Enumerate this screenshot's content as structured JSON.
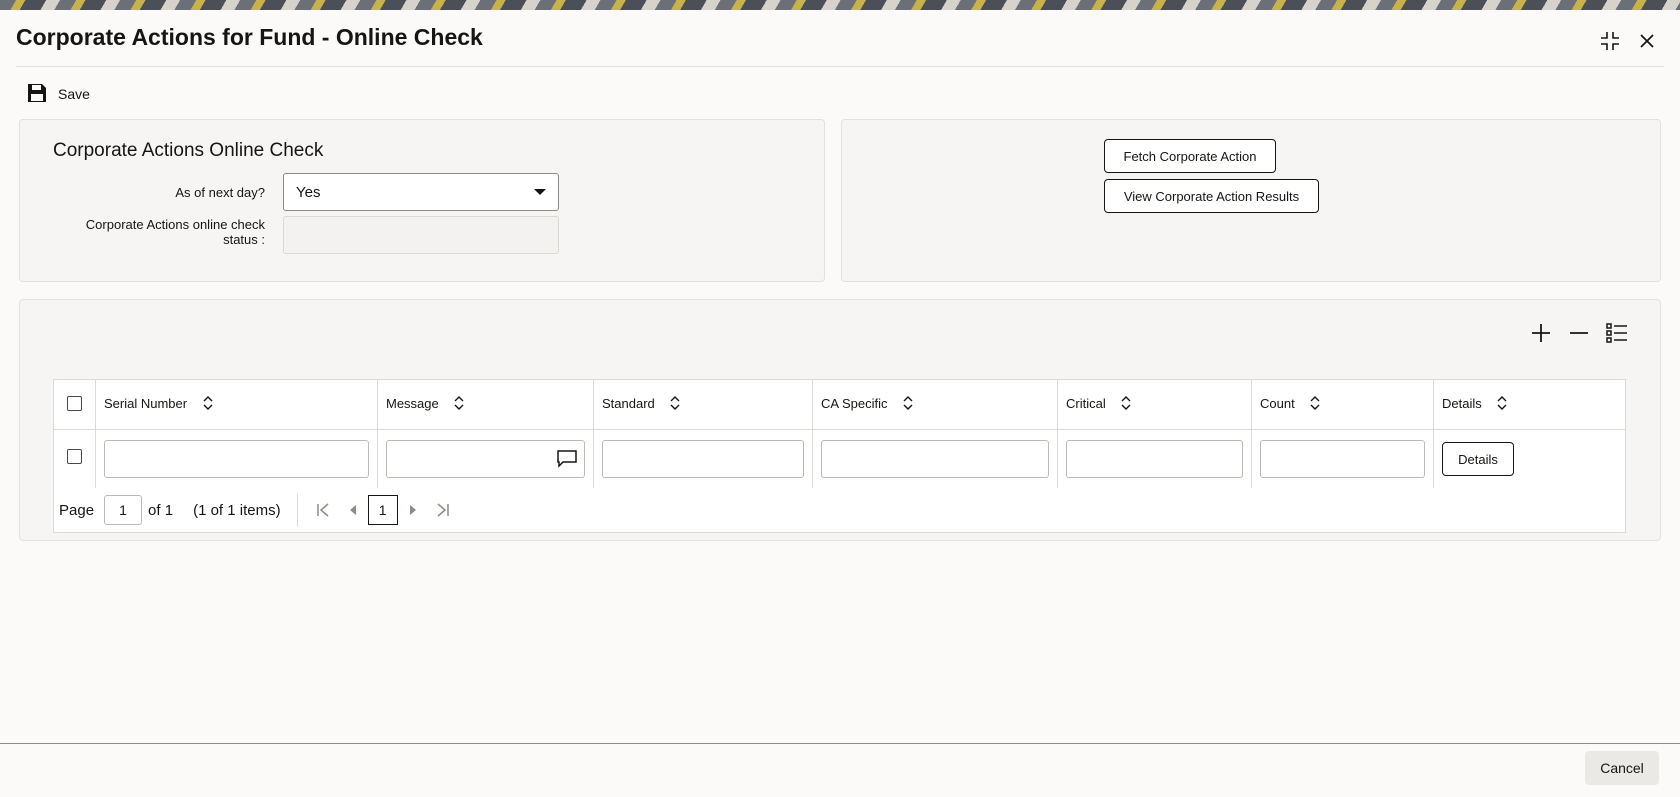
{
  "window": {
    "title": "Corporate Actions for Fund - Online Check",
    "maximize_icon": "collapse-icon",
    "close_icon": "close-icon"
  },
  "toolbar": {
    "save_label": "Save",
    "save_icon": "floppy-disk-icon"
  },
  "check_panel": {
    "section_title": "Corporate Actions Online Check",
    "as_of_next_day_label": "As of next day?",
    "as_of_next_day_value": "Yes",
    "status_label_line1": "Corporate Actions online check",
    "status_label_line2": "status :",
    "status_value": ""
  },
  "actions_panel": {
    "fetch_label": "Fetch Corporate Action",
    "view_results_label": "View Corporate Action Results"
  },
  "grid": {
    "tools": [
      "add-row-icon",
      "remove-row-icon",
      "column-list-icon"
    ],
    "columns": [
      "Serial Number",
      "Message",
      "Standard",
      "CA Specific",
      "Critical",
      "Count",
      "Details"
    ],
    "row": {
      "serial_number": "",
      "message": "",
      "standard": "",
      "ca_specific": "",
      "critical": "",
      "count": "",
      "details_button": "Details"
    }
  },
  "pager": {
    "page_label": "Page",
    "page_value": "1",
    "of_label": "of 1",
    "items_label": "(1 of 1 items)",
    "current_page": "1"
  },
  "footer": {
    "cancel_label": "Cancel"
  }
}
